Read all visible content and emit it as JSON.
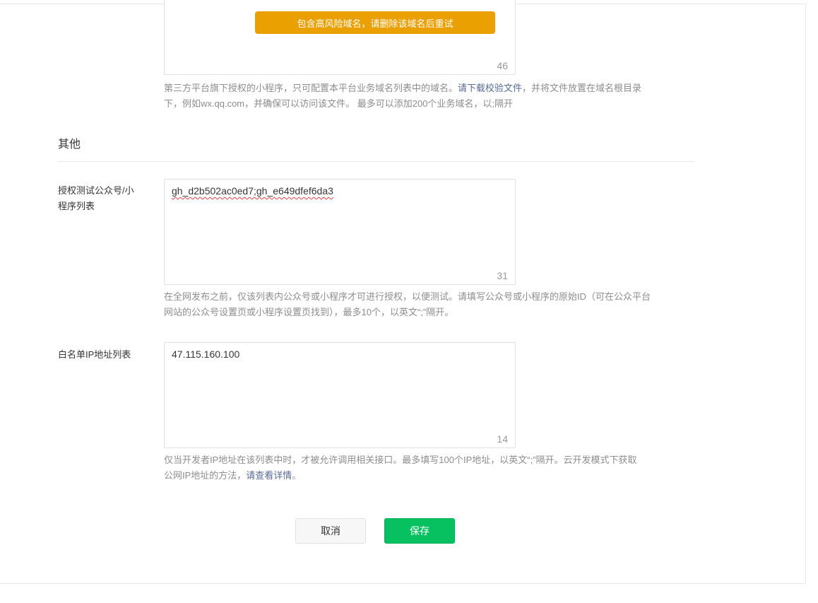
{
  "domain_section": {
    "warning_button": "包含高风险域名，请删除该域名后重试",
    "counter": "46",
    "tip_part1": "第三方平台旗下授权的小程序，只可配置本平台业务域名列表中的域名。",
    "tip_link": "请下载校验文件",
    "tip_part2": "，并将文件放置在域名根目录",
    "tip_line2": "下，例如wx.qq.com，并确保可以访问该文件。 最多可以添加200个业务域名，以;隔开"
  },
  "other_section": {
    "title": "其他"
  },
  "test_accounts": {
    "label_line1": "授权测试公众号/小",
    "label_line2": "程序列表",
    "value": "gh_d2b502ac0ed7;gh_e649dfef6da3",
    "counter": "31",
    "tip_line1": "在全网发布之前，仅该列表内公众号或小程序才可进行授权，以便测试。请填写公众号或小程序的原始ID（可在公众平台",
    "tip_line2": "网站的公众号设置页或小程序设置页找到），最多10个，以英文“;”隔开。"
  },
  "ip_whitelist": {
    "label": "白名单IP地址列表",
    "value": "47.115.160.100",
    "counter": "14",
    "tip_line1": "仅当开发者IP地址在该列表中时，才被允许调用相关接口。最多填写100个IP地址，以英文“;”隔开。云开发模式下获取",
    "tip_line2_part1": "公网IP地址的方法，",
    "tip_link": "请查看详情",
    "tip_line2_part2": "。"
  },
  "actions": {
    "cancel_label": "取消",
    "save_label": "保存"
  },
  "colors": {
    "warning": "#eaa000",
    "primary": "#07c160",
    "link": "#576b95"
  }
}
